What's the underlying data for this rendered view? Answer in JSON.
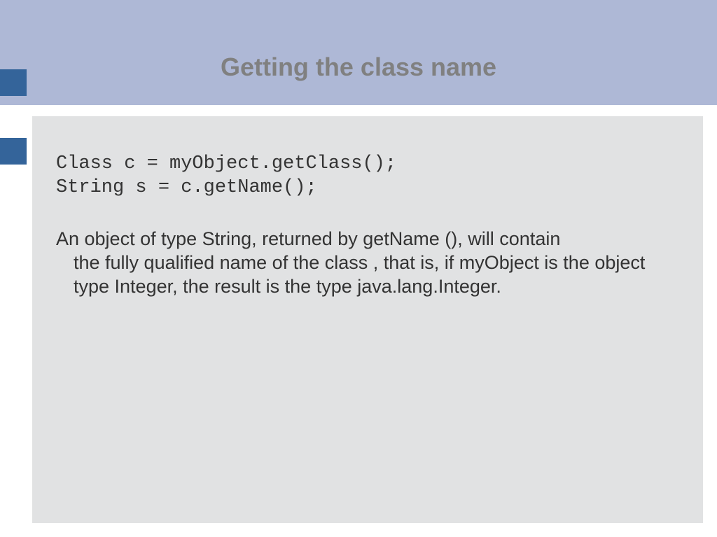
{
  "slide": {
    "title": "Getting the class name",
    "code_line1": "Class c = myObject.getClass();",
    "code_line2": "String s = c.getName();",
    "description_line1": "An object of type String, returned by getName (), will contain",
    "description_rest": "the fully qualified name of the class , that is, if myObject is the object type Integer, the result is the type java.lang.Integer."
  }
}
